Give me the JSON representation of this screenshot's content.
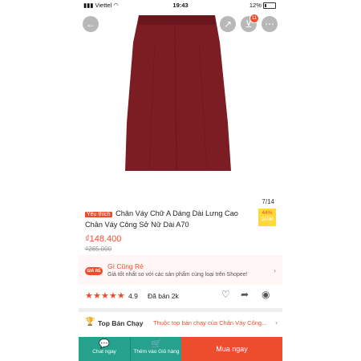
{
  "status": {
    "carrier": "Viettel",
    "time": "19:43",
    "battery": "12%"
  },
  "header": {
    "back_icon": "back-arrow-icon",
    "share_icon": "share-icon",
    "cart_icon": "cart-icon",
    "cart_count": "11",
    "more_icon": "more-icon"
  },
  "gallery": {
    "counter": "7/14"
  },
  "product": {
    "badge": "Yêu thích",
    "title": "Chân Váy Chữ A Dáng Dài Lưng Cao Chân Váy Công Sở Nữ Dài A70",
    "discount_pct": "44%",
    "discount_label": "GIẢM",
    "price": "₫148.400",
    "old_price": "₫265.000"
  },
  "promo": {
    "tag": "GIÁ RẺ",
    "title": "Gì Cũng Rẻ",
    "subtitle": "Giá tốt nhất so với các sản phẩm cùng loại trên Shopee!"
  },
  "rating": {
    "score": "4.9",
    "sold": "Đã bán 2k",
    "stars": 5
  },
  "top": {
    "label": "Top Bán Chạy",
    "desc": "Thuộc top bán chạy của Chân Váy Công..."
  },
  "bottom": {
    "chat": "Chat ngay",
    "add_cart": "Thêm vào Giỏ hàng",
    "buy": "Mua ngay"
  },
  "colors": {
    "accent": "#ee4d2d",
    "teal": "#25a18e",
    "skirt": "#7b1d23"
  }
}
